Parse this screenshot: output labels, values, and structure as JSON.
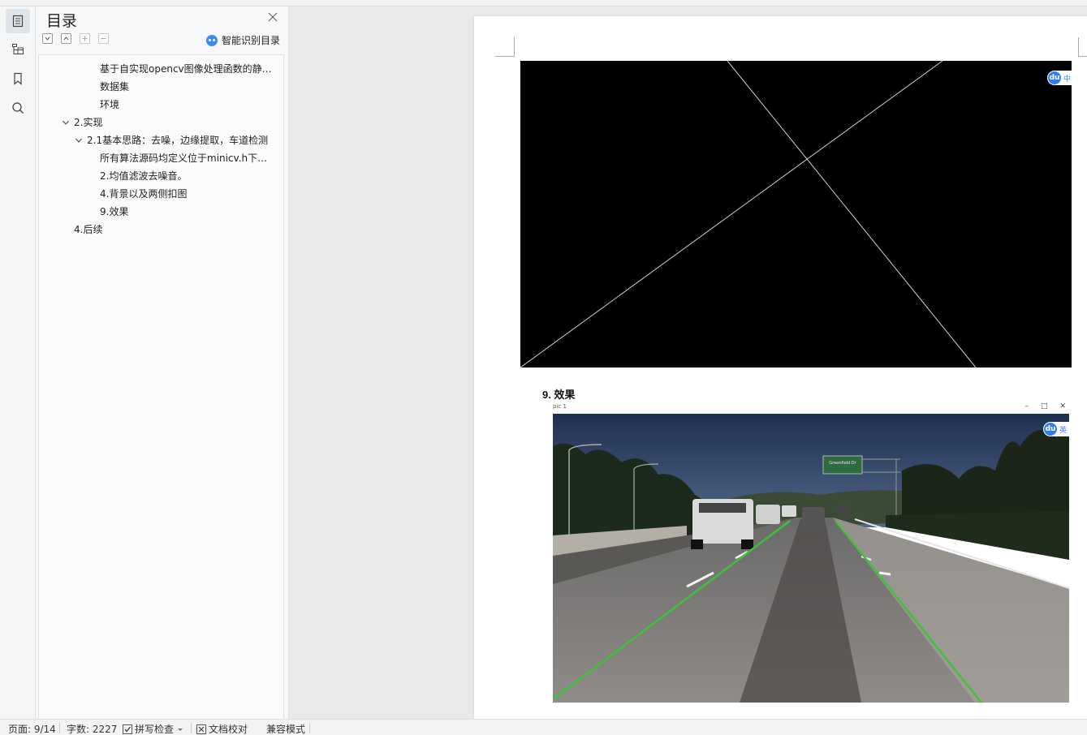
{
  "toc_panel": {
    "title": "目录",
    "smart_toc_label": "智能识别目录",
    "items": [
      {
        "label": "基于自实现opencv图像处理函数的静态图像车道线检测",
        "level": 3
      },
      {
        "label": "数据集",
        "level": 3
      },
      {
        "label": "环境",
        "level": 3
      },
      {
        "label": "2.实现",
        "level": 1
      },
      {
        "label": "2.1基本思路：去噪，边缘提取，车道检测",
        "level": 2
      },
      {
        "label": "所有算法源码均定义位于minicv.h下的函数",
        "level": 3
      },
      {
        "label": "2.均值滤波去噪音。",
        "level": 3
      },
      {
        "label": "4.背景以及两侧扣图",
        "level": 3
      },
      {
        "label": "9.效果",
        "level": 3
      },
      {
        "label": "4.后续",
        "level": 2
      }
    ]
  },
  "document": {
    "badge_1": "中",
    "badge_2": "英",
    "heading": "9. 效果",
    "window_title": "pic 1",
    "window_controls": [
      "–",
      "□",
      "✕"
    ],
    "road_sign": "Greenfield Dr"
  },
  "status_bar": {
    "page": "页面: 9/14",
    "word_count": "字数: 2227",
    "spell_check": "拼写检查",
    "doc_review": "文档校对",
    "compat_mode": "兼容模式"
  },
  "colors": {
    "accent": "#3d8bf2",
    "lane_line": "#3ec23a"
  }
}
